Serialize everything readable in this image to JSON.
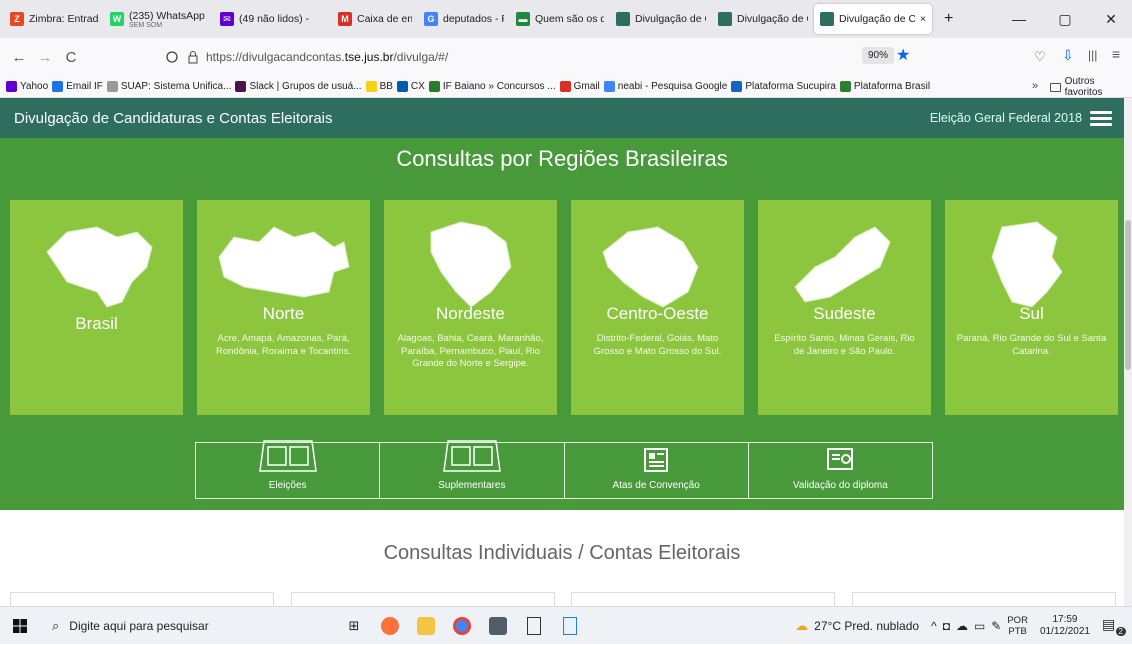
{
  "browser": {
    "tabs": [
      {
        "label": "Zimbra: Entrada",
        "sub": "",
        "color": "#e8471f",
        "glyph": "Z"
      },
      {
        "label": "(235) WhatsApp",
        "sub": "SEM SOM",
        "color": "#25d366",
        "glyph": "W"
      },
      {
        "label": "(49 não lidos) -",
        "sub": "",
        "color": "#6001d2",
        "glyph": "✉"
      },
      {
        "label": "Caixa de entrad",
        "sub": "",
        "color": "#d93025",
        "glyph": "M"
      },
      {
        "label": "deputados - Pes",
        "sub": "",
        "color": "#4285f4",
        "glyph": "G"
      },
      {
        "label": "Quem são os de",
        "sub": "",
        "color": "#1d8a3a",
        "glyph": "▬"
      },
      {
        "label": "Divulgação de Cand",
        "sub": "",
        "color": "#2d6e5e",
        "glyph": ""
      },
      {
        "label": "Divulgação de Cand",
        "sub": "",
        "color": "#2d6e5e",
        "glyph": ""
      },
      {
        "label": "Divulgação de Ca",
        "sub": "",
        "color": "#2d6e5e",
        "glyph": ""
      }
    ],
    "active_tab_close": "×",
    "new_tab": "+",
    "window_controls": {
      "minimize": "—",
      "maximize": "▢",
      "close": "✕"
    },
    "nav": {
      "back": "←",
      "forward": "→",
      "reload": "C"
    },
    "url": {
      "prefix": "https://divulgacandcontas.",
      "host": "tse.jus.br",
      "path": "/divulga/#/"
    },
    "zoom": "90%",
    "bookmarks": [
      {
        "label": "Yahoo",
        "color": "#6001d2"
      },
      {
        "label": "Email IF",
        "color": "#1a73e8"
      },
      {
        "label": "SUAP: Sistema Unifica...",
        "color": "#999999"
      },
      {
        "label": "Slack | Grupos de usuá...",
        "color": "#4a154b"
      },
      {
        "label": "BB",
        "color": "#f7d117"
      },
      {
        "label": "CX",
        "color": "#005ca9"
      },
      {
        "label": "IF Baiano » Concursos ...",
        "color": "#2a7a2a"
      },
      {
        "label": "Gmail",
        "color": "#d93025"
      },
      {
        "label": "neabi - Pesquisa Google",
        "color": "#4285f4"
      },
      {
        "label": "Plataforma Sucupira",
        "color": "#1565c0"
      },
      {
        "label": "Plataforma Brasil",
        "color": "#2e7d32"
      }
    ],
    "bookmarks_more": "»",
    "other_bookmarks": "Outros favoritos"
  },
  "site": {
    "brand": "Divulgação de Candidaturas e Contas Eleitorais",
    "election": "Eleição Geral Federal 2018",
    "regions_title": "Consultas por Regiões Brasileiras",
    "regions": [
      {
        "name": "Brasil",
        "desc": ""
      },
      {
        "name": "Norte",
        "desc": "Acre, Amapá, Amazonas, Pará, Rondônia, Roraima e Tocantins."
      },
      {
        "name": "Nordeste",
        "desc": "Alagoas, Bahia, Ceará, Maranhão, Paraíba, Pernambuco, Piauí, Rio Grande do Norte e Sergipe."
      },
      {
        "name": "Centro-Oeste",
        "desc": "Distrito-Federal, Goiás, Mato Grosso e Mato Grosso do Sul."
      },
      {
        "name": "Sudeste",
        "desc": "Espírito Santo, Minas Gerais, Rio de Janeiro e São Paulo."
      },
      {
        "name": "Sul",
        "desc": "Paraná, Rio Grande do Sul e Santa Catarina."
      }
    ],
    "buttons": [
      {
        "label": "Eleições",
        "icon": "voting-machine-icon"
      },
      {
        "label": "Suplementares",
        "icon": "voting-machine-icon"
      },
      {
        "label": "Atas de Convenção",
        "icon": "newspaper-icon"
      },
      {
        "label": "Validação do diploma",
        "icon": "certificate-icon"
      }
    ],
    "individual_title": "Consultas Individuais / Contas Eleitorais"
  },
  "taskbar": {
    "search_placeholder": "Digite aqui para pesquisar",
    "weather": "27°C  Pred. nublado",
    "lang_top": "POR",
    "lang_bottom": "PTB",
    "time": "17:59",
    "date": "01/12/2021",
    "notifications": "2"
  },
  "colors": {
    "header": "#2d6e5e",
    "green_bg": "#47993a",
    "tile": "#8cc63f"
  }
}
